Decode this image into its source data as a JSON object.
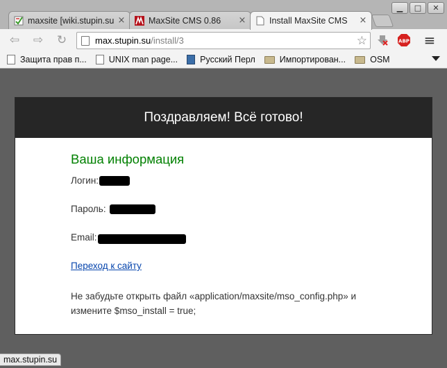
{
  "browser": {
    "tabs": [
      {
        "title": "maxsite [wiki.stupin.su",
        "favicon": "wiki-icon",
        "active": false
      },
      {
        "title": "MaxSite CMS 0.86",
        "favicon": "maxsite-icon",
        "active": false
      },
      {
        "title": "Install MaxSite CMS",
        "favicon": "page-icon",
        "active": true
      }
    ],
    "close_glyph": "×",
    "window_controls": {
      "minimize": "▁",
      "maximize": "□",
      "close": "✕"
    },
    "nav": {
      "back": "⇦",
      "forward": "⇨",
      "reload": "↻"
    },
    "url": {
      "host": "max.stupin.su",
      "path": "/install/3"
    },
    "star_glyph": "☆",
    "menu_glyph": "≡",
    "abp_label": "ABP",
    "bookmarks": [
      {
        "label": "Защита прав п...",
        "icon": "document-icon"
      },
      {
        "label": "UNIX man page...",
        "icon": "document-icon"
      },
      {
        "label": "Русский Перл",
        "icon": "perl-icon"
      },
      {
        "label": "Импортирован...",
        "icon": "folder-icon"
      },
      {
        "label": "OSM",
        "icon": "folder-icon"
      }
    ],
    "status_text": "max.stupin.su"
  },
  "page": {
    "header_title": "Поздравляем! Всё готово!",
    "section_title": "Ваша информация",
    "login_label": "Логин:",
    "password_label": "Пароль:",
    "email_label": "Email:",
    "link_text": "Переход к сайту",
    "note_text": "Не забудьте открыть файл «application/maxsite/mso_config.php» и измените $mso_install = true;"
  },
  "colors": {
    "header_bg": "#262626",
    "section_title": "#008000",
    "link": "#0645ad",
    "page_bg": "#5f5f5f"
  }
}
